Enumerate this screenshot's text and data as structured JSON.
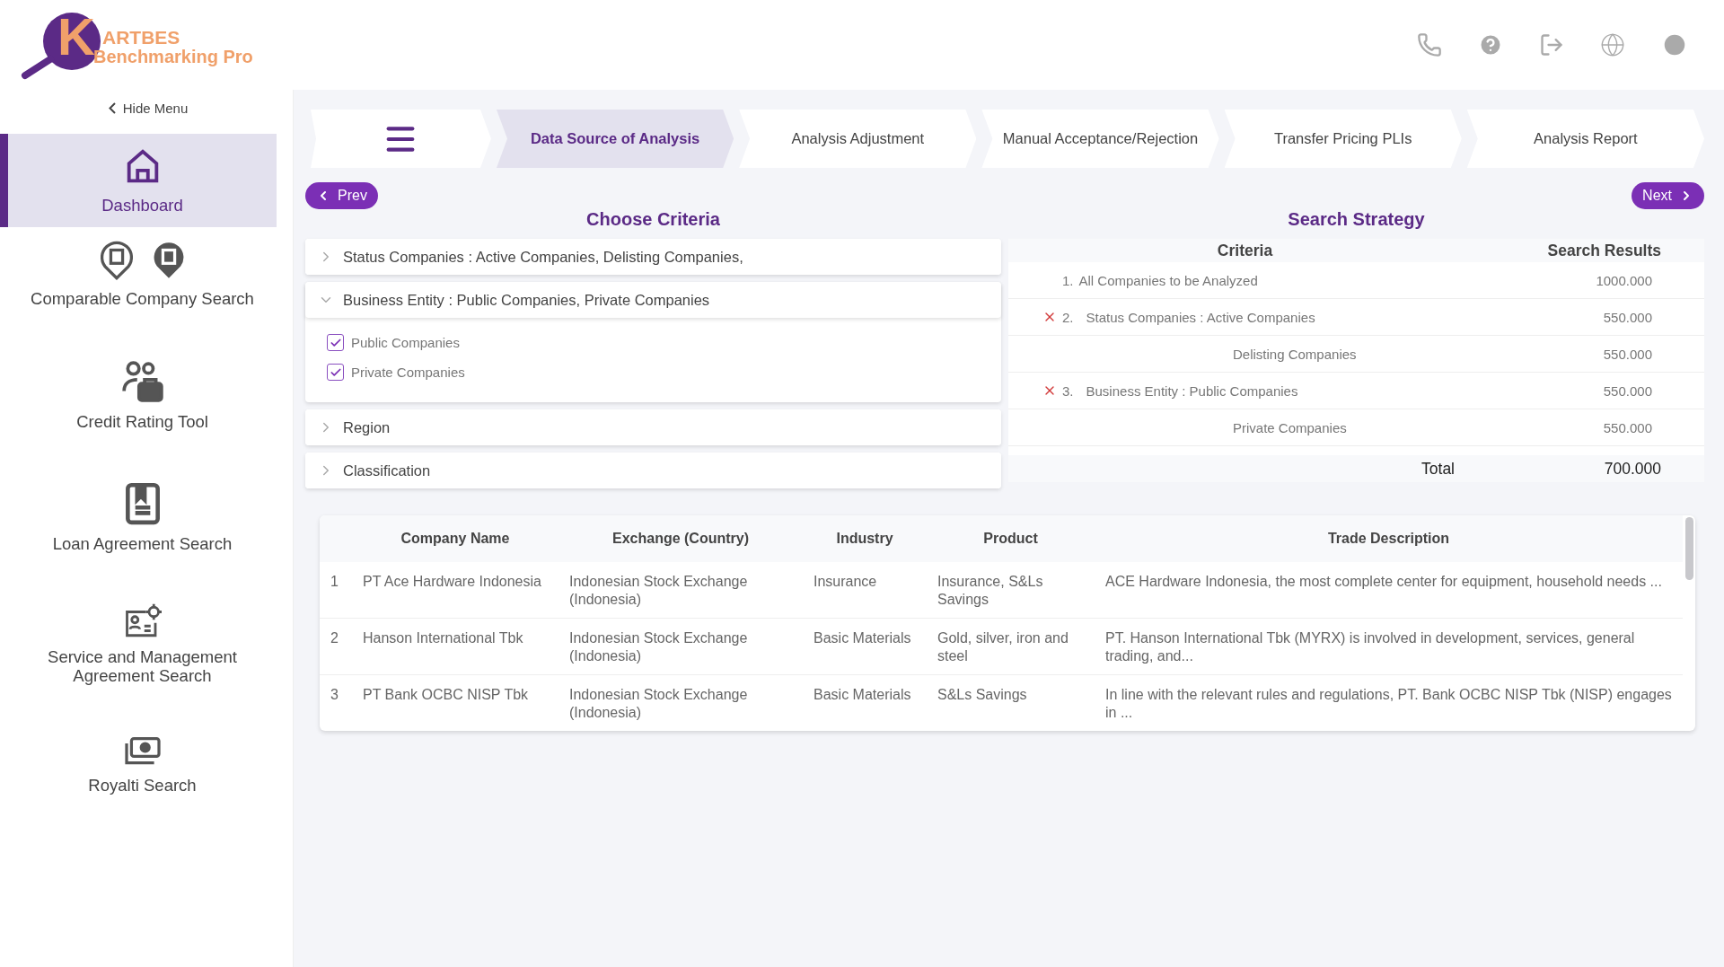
{
  "logo": {
    "initial": "K",
    "name": "ARTBES",
    "tagline": "Benchmarking Pro"
  },
  "sidebar": {
    "hide_menu": "Hide Menu",
    "items": [
      {
        "label": "Dashboard",
        "selected": true
      },
      {
        "label": "Comparable Company Search",
        "selected": false
      },
      {
        "label": "Credit Rating Tool",
        "selected": false
      },
      {
        "label": "Loan Agreement Search",
        "selected": false
      },
      {
        "label": "Service and Management Agreement Search",
        "selected": false
      },
      {
        "label": "Royalti Search",
        "selected": false
      }
    ]
  },
  "steps": [
    {
      "label": "Data Source of Analysis",
      "selected": true
    },
    {
      "label": "Analysis Adjustment",
      "selected": false
    },
    {
      "label": "Manual Acceptance/Rejection",
      "selected": false
    },
    {
      "label": "Transfer Pricing PLIs",
      "selected": false
    },
    {
      "label": "Analysis Report",
      "selected": false
    }
  ],
  "prev": "Prev",
  "next": "Next",
  "criteria": {
    "title": "Choose Criteria",
    "panels": [
      {
        "label": "Status Companies  : Active Companies,  Delisting Companies,",
        "expanded": false
      },
      {
        "label": "Business Entity  : Public Companies,  Private Companies",
        "expanded": true,
        "options": [
          {
            "label": "Public Companies",
            "checked": true
          },
          {
            "label": "Private Companies",
            "checked": true
          }
        ]
      },
      {
        "label": "Region",
        "expanded": false
      },
      {
        "label": "Classification",
        "expanded": false
      }
    ]
  },
  "strategy": {
    "title": "Search Strategy",
    "columns": [
      "Criteria",
      "Search Results"
    ],
    "rows": [
      {
        "kind": "main",
        "number": "1.",
        "label": "All Companies to be Analyzed",
        "result": "1000.000",
        "removable": false
      },
      {
        "kind": "main",
        "number": "2.",
        "label": "Status Companies : Active Companies",
        "result": "550.000",
        "removable": true
      },
      {
        "kind": "sub",
        "label": "Delisting Companies",
        "result": "550.000",
        "removable": false
      },
      {
        "kind": "main",
        "number": "3.",
        "label": "Business Entity : Public Companies",
        "result": "550.000",
        "removable": true
      },
      {
        "kind": "sub",
        "label": "Private Companies",
        "result": "550.000",
        "removable": false
      }
    ],
    "total": {
      "label": "Total",
      "value": "700.000"
    }
  },
  "table": {
    "columns": [
      "Company Name",
      "Exchange (Country)",
      "Industry",
      "Product",
      "Trade Description"
    ],
    "rows": [
      {
        "index": "1",
        "cells": [
          "PT Ace Hardware Indonesia",
          "Indonesian Stock Exchange (Indonesia)",
          "Insurance",
          "Insurance, S&Ls Savings",
          "ACE Hardware Indonesia, the most complete center for equipment, household needs ..."
        ]
      },
      {
        "index": "2",
        "cells": [
          "Hanson International Tbk",
          "Indonesian Stock Exchange (Indonesia)",
          "Basic Materials",
          "Gold, silver, iron and steel",
          "PT. Hanson International Tbk (MYRX) is involved in development, services, general trading, and..."
        ]
      },
      {
        "index": "3",
        "cells": [
          "PT Bank OCBC NISP Tbk",
          "Indonesian Stock Exchange (Indonesia)",
          "Basic Materials",
          "S&Ls Savings",
          "In line with the relevant rules and regulations, PT. Bank OCBC NISP Tbk (NISP) engages in ..."
        ]
      }
    ]
  }
}
